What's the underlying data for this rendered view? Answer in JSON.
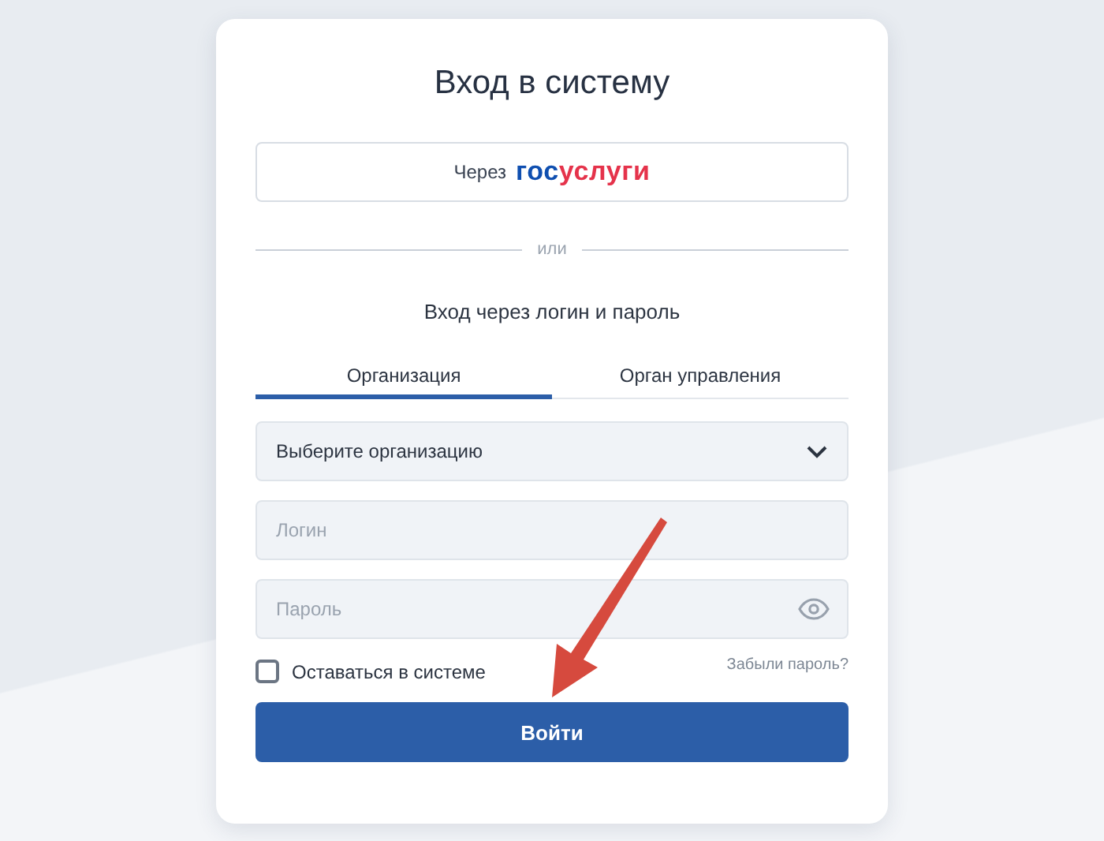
{
  "title": "Вход в систему",
  "esia_button": {
    "prefix": "Через",
    "logo": [
      {
        "text": "гос",
        "color": "#0f4fb0"
      },
      {
        "text": "услуги",
        "color": "#e5334b"
      }
    ]
  },
  "divider_text": "или",
  "subtitle": "Вход через логин и пароль",
  "tabs": [
    {
      "label": "Организация",
      "selected": true
    },
    {
      "label": "Орган управления",
      "selected": false
    }
  ],
  "organization_select": {
    "value": "Выберите организацию"
  },
  "login_field": {
    "placeholder": "Логин"
  },
  "password_field": {
    "placeholder": "Пароль"
  },
  "remember": {
    "label": "Оставаться в системе",
    "checked": false
  },
  "forgot_link": "Забыли пароль?",
  "submit": "Войти"
}
